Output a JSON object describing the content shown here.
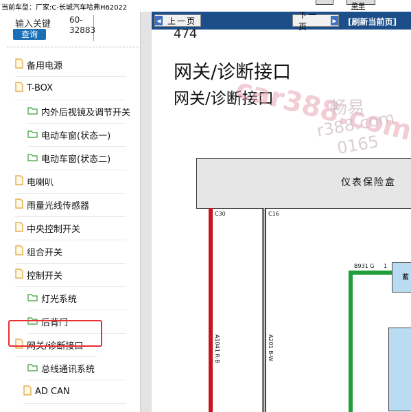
{
  "topbar": {
    "current_vehicle": "当前车型：厂家:C-长城汽车哈弗H62022",
    "right_label": "菜单"
  },
  "sidebar": {
    "search_label": "输入关键",
    "search_button": "查询",
    "phone_line1": "60-",
    "phone_line2": "32883",
    "items": [
      {
        "label": "备用电源",
        "icon": "file-icon"
      },
      {
        "label": "T-BOX",
        "icon": "file-icon"
      },
      {
        "label": "内外后视镜及调节开关",
        "icon": "folder-icon"
      },
      {
        "label": "电动车窗(状态一)",
        "icon": "folder-icon"
      },
      {
        "label": "电动车窗(状态二)",
        "icon": "folder-icon"
      },
      {
        "label": "电喇叭",
        "icon": "file-icon"
      },
      {
        "label": "雨量光线传感器",
        "icon": "file-icon"
      },
      {
        "label": "中央控制开关",
        "icon": "file-icon"
      },
      {
        "label": "组合开关",
        "icon": "file-icon"
      },
      {
        "label": "控制开关",
        "icon": "file-icon"
      },
      {
        "label": "灯光系统",
        "icon": "folder-icon"
      },
      {
        "label": "后背门",
        "icon": "folder-icon"
      },
      {
        "label": "网关/诊断接口",
        "icon": "file-icon"
      },
      {
        "label": "总线通讯系统",
        "icon": "folder-icon"
      },
      {
        "label": "AD CAN",
        "icon": "file-icon"
      }
    ]
  },
  "navbar": {
    "prev": "上一页",
    "next": "下一页",
    "refresh": "[刷新当前页]"
  },
  "content": {
    "page_number": "474",
    "title": "网关/诊断接口",
    "subtitle": "网关/诊断接口",
    "fuse_box_label": "仪表保险盒",
    "wire1_connector": "C30",
    "wire2_connector": "C16",
    "wire1_code": "A1041 R-B",
    "wire2_code": "A201 B-W",
    "wire3_code": "B931 G",
    "pin": "1",
    "battery_label": "蓄"
  },
  "watermark": {
    "main": "car388.com",
    "cn": "畅易",
    "phone1": "r388.com",
    "phone2": "0165"
  },
  "colors": {
    "nav_bg": "#1c4f8a",
    "search_btn": "#1a6fb5",
    "highlight": "#e83030",
    "wire_red": "#c8141e",
    "wire_green": "#1f9e3a",
    "box_blue": "#b9dcf2"
  }
}
